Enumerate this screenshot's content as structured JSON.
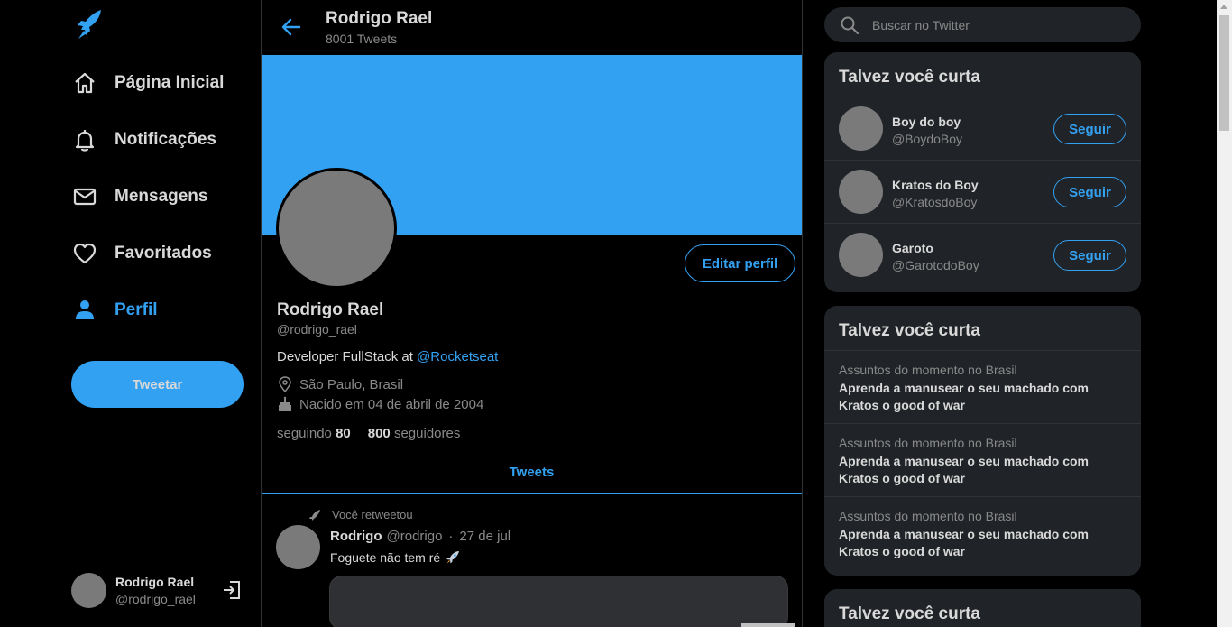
{
  "leftnav": {
    "logo_icon": "rocket-bird-logo",
    "items": [
      {
        "label": "Página Inicial",
        "icon": "home-icon",
        "active": false
      },
      {
        "label": "Notificações",
        "icon": "bell-icon",
        "active": false
      },
      {
        "label": "Mensagens",
        "icon": "mail-icon",
        "active": false
      },
      {
        "label": "Favoritados",
        "icon": "heart-icon",
        "active": false
      },
      {
        "label": "Perfil",
        "icon": "person-icon",
        "active": true
      }
    ],
    "tweet_button": "Tweetar",
    "me": {
      "name": "Rodrigo Rael",
      "handle": "@rodrigo_rael",
      "exit_icon": "exit-icon"
    }
  },
  "header": {
    "title": "Rodrigo Rael",
    "tweet_count": "8001 Tweets"
  },
  "profile": {
    "edit_button": "Editar perfil",
    "name": "Rodrigo Rael",
    "handle": "@rodrigo_rael",
    "bio_text": "Developer FullStack at ",
    "bio_link": "@Rocketseat",
    "location": "São Paulo, Brasil",
    "birthday": "Nacido em 04 de abril de 2004",
    "following_label": "seguindo",
    "following_count": "80",
    "followers_count": "800",
    "followers_label": "seguidores"
  },
  "tabs": {
    "tweets": "Tweets"
  },
  "post": {
    "retweet_note": "Você retweetou",
    "author": "Rodrigo",
    "handle": "@rodrigo",
    "dot": "·",
    "date": "27 de jul",
    "text": "Foguete não tem ré"
  },
  "search": {
    "placeholder": "Buscar no Twitter"
  },
  "who_to_follow": {
    "title": "Talvez você curta",
    "users": [
      {
        "name": "Boy do boy",
        "handle": "@BoydoBoy",
        "button": "Seguir"
      },
      {
        "name": "Kratos do Boy",
        "handle": "@KratosdoBoy",
        "button": "Seguir"
      },
      {
        "name": "Garoto",
        "handle": "@GarotodoBoy",
        "button": "Seguir"
      }
    ]
  },
  "trends": {
    "title": "Talvez você curta",
    "items": [
      {
        "context": "Assuntos do momento no Brasil",
        "topic": "Aprenda a manusear o seu machado com Kratos o good of war"
      },
      {
        "context": "Assuntos do momento no Brasil",
        "topic": "Aprenda a manusear o seu machado com Kratos o good of war"
      },
      {
        "context": "Assuntos do momento no Brasil",
        "topic": "Aprenda a manusear o seu machado com Kratos o good of war"
      }
    ]
  },
  "third_panel": {
    "title": "Talvez você curta"
  },
  "colors": {
    "accent": "#33a1f2",
    "background": "#000000",
    "panel": "#202327",
    "muted": "#8a8a8a",
    "text": "#d9d9d9",
    "avatar": "#7a7a7a"
  }
}
